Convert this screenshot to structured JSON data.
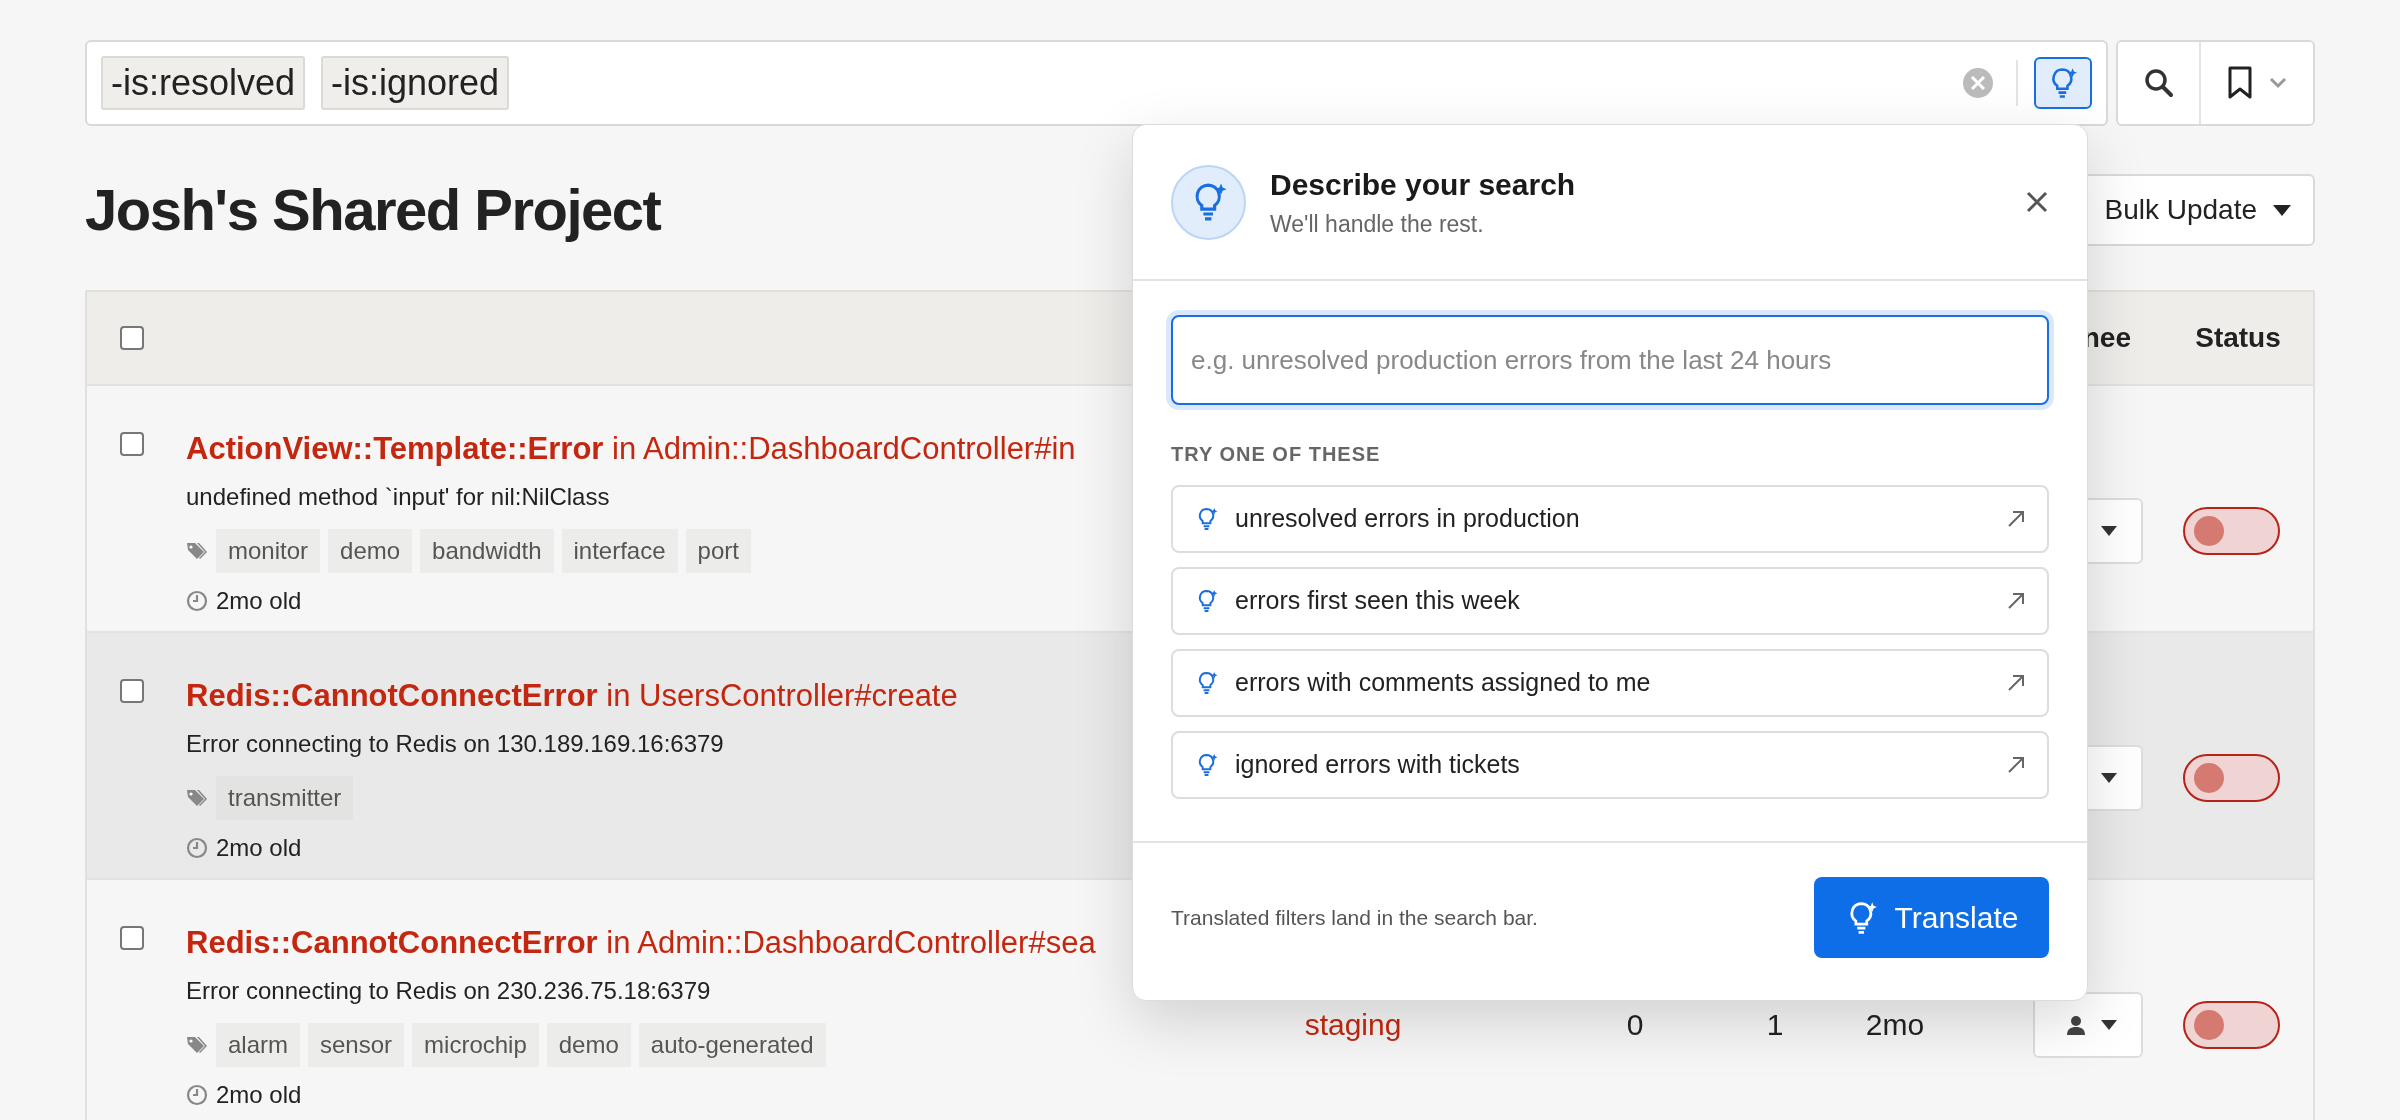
{
  "search_bar": {
    "chips": [
      "-is:resolved",
      "-is:ignored"
    ]
  },
  "page_title": "Josh's Shared Project",
  "bulk_update": {
    "label": "Bulk Update"
  },
  "table": {
    "header_checked": false,
    "columns": [
      "nee",
      "Status"
    ],
    "rows": [
      {
        "checked": false,
        "highlighted": false,
        "title": "**ActionView::Template::Error** in Admin::DashboardController#in",
        "message": "undefined method `input' for nil:NilClass",
        "tags": [
          "monitor",
          "demo",
          "bandwidth",
          "interface",
          "port"
        ],
        "age": "2mo old",
        "resolved": false
      },
      {
        "checked": false,
        "highlighted": true,
        "title": "**Redis::CannotConnectError** in UsersController#create",
        "message": "Error connecting to Redis on 130.189.169.16:6379",
        "tags": [
          "transmitter"
        ],
        "age": "2mo old",
        "resolved": false
      },
      {
        "checked": false,
        "highlighted": false,
        "title": "**Redis::CannotConnectError** in Admin::DashboardController#sea",
        "message": "Error connecting to Redis on 230.236.75.18:6379",
        "tags": [
          "alarm",
          "sensor",
          "microchip",
          "demo",
          "auto-generated"
        ],
        "age": "2mo old",
        "cells": [
          "staging",
          "0",
          "1",
          "2mo"
        ],
        "resolved": false
      }
    ]
  },
  "popup": {
    "title": "Describe your search",
    "subtitle": "We'll handle the rest.",
    "placeholder": "e.g. unresolved production errors from the last 24 hours",
    "section_label": "TRY ONE OF THESE",
    "suggestions": [
      "unresolved errors in production",
      "errors first seen this week",
      "errors with comments assigned to me",
      "ignored errors with tickets"
    ],
    "footer_note": "Translated filters land in the search bar.",
    "button": "Translate"
  }
}
